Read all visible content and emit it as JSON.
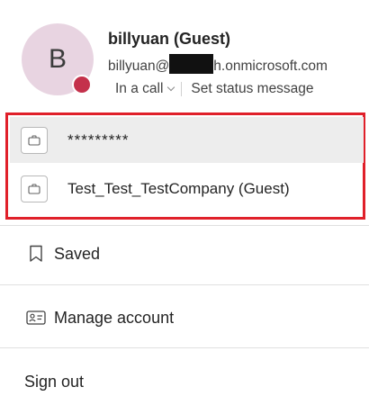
{
  "profile": {
    "avatar_initial": "B",
    "name": "billyuan (Guest)",
    "email_prefix": "billyuan@",
    "email_suffix": "h.onmicrosoft.com",
    "status": "In a call",
    "set_status_label": "Set status message",
    "presence_color": "#c4314b",
    "avatar_color": "#e8d4e1"
  },
  "accounts": [
    {
      "label": "*********",
      "active": true
    },
    {
      "label": "Test_Test_TestCompany (Guest)",
      "active": false
    }
  ],
  "accounts_highlight_color": "#e0202a",
  "menu": {
    "saved_label": "Saved",
    "manage_account_label": "Manage account",
    "sign_out_label": "Sign out"
  },
  "icons": {
    "org": "briefcase-icon",
    "saved": "bookmark-icon",
    "manage_account": "contact-card-icon"
  }
}
